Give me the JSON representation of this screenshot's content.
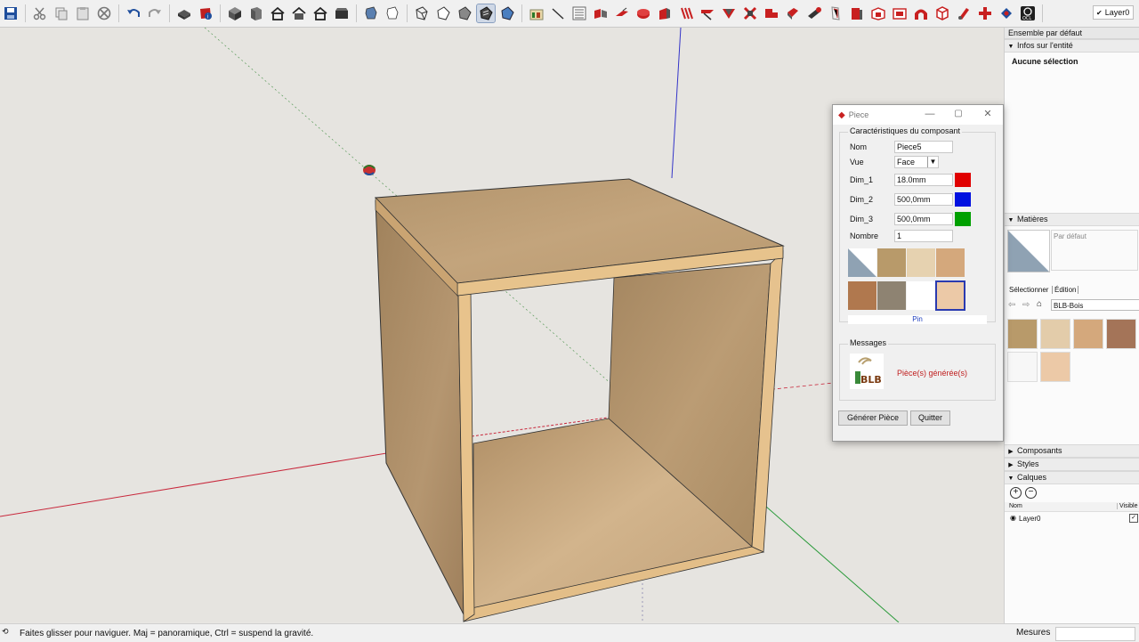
{
  "toolbar": {
    "icons": [
      "save-icon",
      "cut-icon",
      "copy-icon",
      "paste-icon",
      "erase-icon",
      "undo-icon",
      "redo-icon",
      "print-icon",
      "model-info-icon",
      "iso-view-icon",
      "top-view-icon",
      "front-view-icon",
      "right-view-icon",
      "back-view-icon",
      "left-view-icon",
      "xray-icon",
      "wireframe-icon",
      "hidden-line-icon",
      "shaded-icon",
      "shaded-texture-icon",
      "monochrome-icon",
      "plugin-icon",
      "line-tool-icon",
      "list-icon"
    ],
    "layer_value": "Layer0"
  },
  "status": {
    "text": "Faites glisser pour naviguer. Maj = panoramique, Ctrl =  suspend la gravité.",
    "measures_label": "Mesures"
  },
  "panel": {
    "tray_title": "Ensemble par défaut",
    "entity_info": {
      "title": "Infos sur l'entité",
      "selection": "Aucune sélection"
    },
    "materials": {
      "title": "Matières",
      "current_name": "Par défaut",
      "tab_select": "Sélectionner",
      "tab_edit": "Édition",
      "library": "BLB-Bois",
      "swatches": [
        "#b89a6a",
        "#e3ccaa",
        "#d4a87c",
        "#a47458",
        "#f7f7f7",
        "#ecc9a7"
      ]
    },
    "components": "Composants",
    "styles": "Styles",
    "layers": {
      "title": "Calques",
      "col_name": "Nom",
      "col_visible": "Visible",
      "rows": [
        {
          "name": "Layer0",
          "visible": true
        }
      ]
    }
  },
  "dialog": {
    "title": "Piece",
    "group_title": "Caractéristiques du composant",
    "fields": {
      "nom": {
        "label": "Nom",
        "value": "Piece5"
      },
      "vue": {
        "label": "Vue",
        "value": "Face"
      },
      "dim1": {
        "label": "Dim_1",
        "value": "18.0mm",
        "color": "#e00000"
      },
      "dim2": {
        "label": "Dim_2",
        "value": "500,0mm",
        "color": "#0010e0"
      },
      "dim3": {
        "label": "Dim_3",
        "value": "500,0mm",
        "color": "#00a000"
      },
      "nombre": {
        "label": "Nombre",
        "value": "1"
      }
    },
    "materials": [
      "default",
      "#b89a6a",
      "#e6d2b0",
      "#d4a87c",
      "#b0784e",
      "#8e8372",
      "#ffffff",
      "#ecc9a7"
    ],
    "selected_material": "Pin",
    "messages_title": "Messages",
    "message": "Pièce(s) générée(s)",
    "logo_text": "BLB",
    "btn_generate": "Générer Pièce",
    "btn_quit": "Quitter"
  },
  "colors": {
    "red_axis": "#c8283c",
    "green_axis": "#2a9a3a",
    "blue_axis": "#3434c8",
    "wood": "#c19b6c",
    "edge": "#e8c08a"
  }
}
